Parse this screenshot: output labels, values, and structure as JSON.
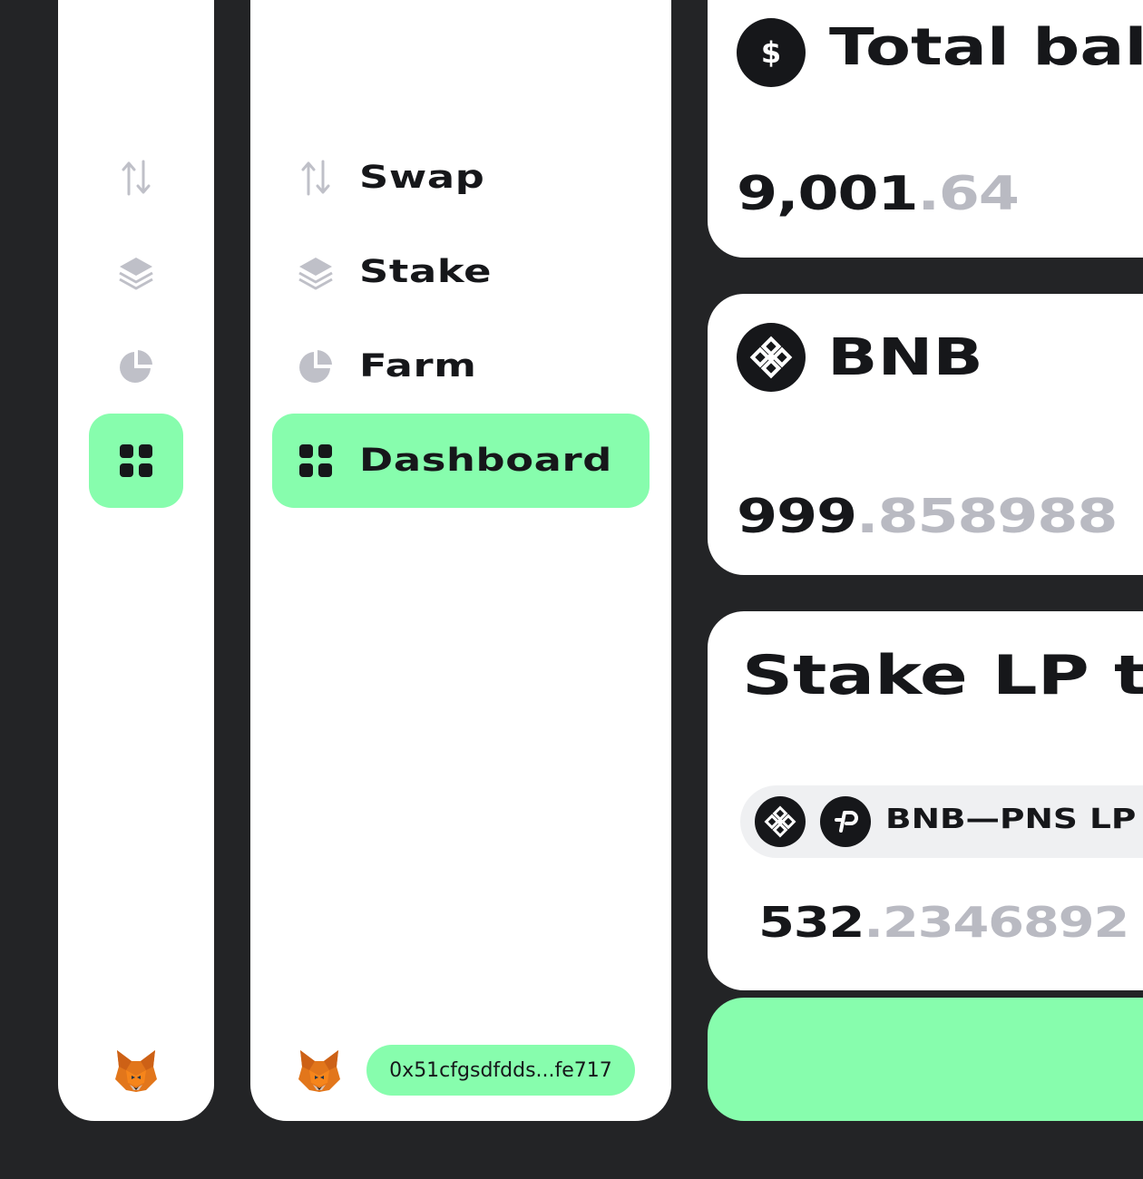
{
  "nav": {
    "items": [
      {
        "label": "Swap",
        "icon": "swap-arrows-icon",
        "active": false
      },
      {
        "label": "Stake",
        "icon": "layers-icon",
        "active": false
      },
      {
        "label": "Farm",
        "icon": "pie-chart-icon",
        "active": false
      },
      {
        "label": "Dashboard",
        "icon": "grid-icon",
        "active": true
      }
    ]
  },
  "wallet": {
    "provider_icon": "metamask-fox-icon",
    "address": "0x51cfgsdfdds...fe717"
  },
  "cards": {
    "total_balance": {
      "icon": "dollar-icon",
      "title": "Total bala",
      "amount_int": "9,001",
      "amount_dec": ".64"
    },
    "bnb": {
      "icon": "bnb-icon",
      "title": "BNB",
      "amount_int": "999",
      "amount_dec": ".858988"
    },
    "stake_lp": {
      "title": "Stake LP t",
      "pair_label": "BNB—PNS LP",
      "pair_icons": [
        "bnb-icon",
        "pns-icon"
      ],
      "amount_int": "532",
      "amount_dec": ".2346892"
    }
  },
  "colors": {
    "background": "#232426",
    "accent": "#87FDAD",
    "text_primary": "#16171A",
    "text_muted": "#B9BAC2",
    "icon_inactive": "#BFC0C8"
  }
}
